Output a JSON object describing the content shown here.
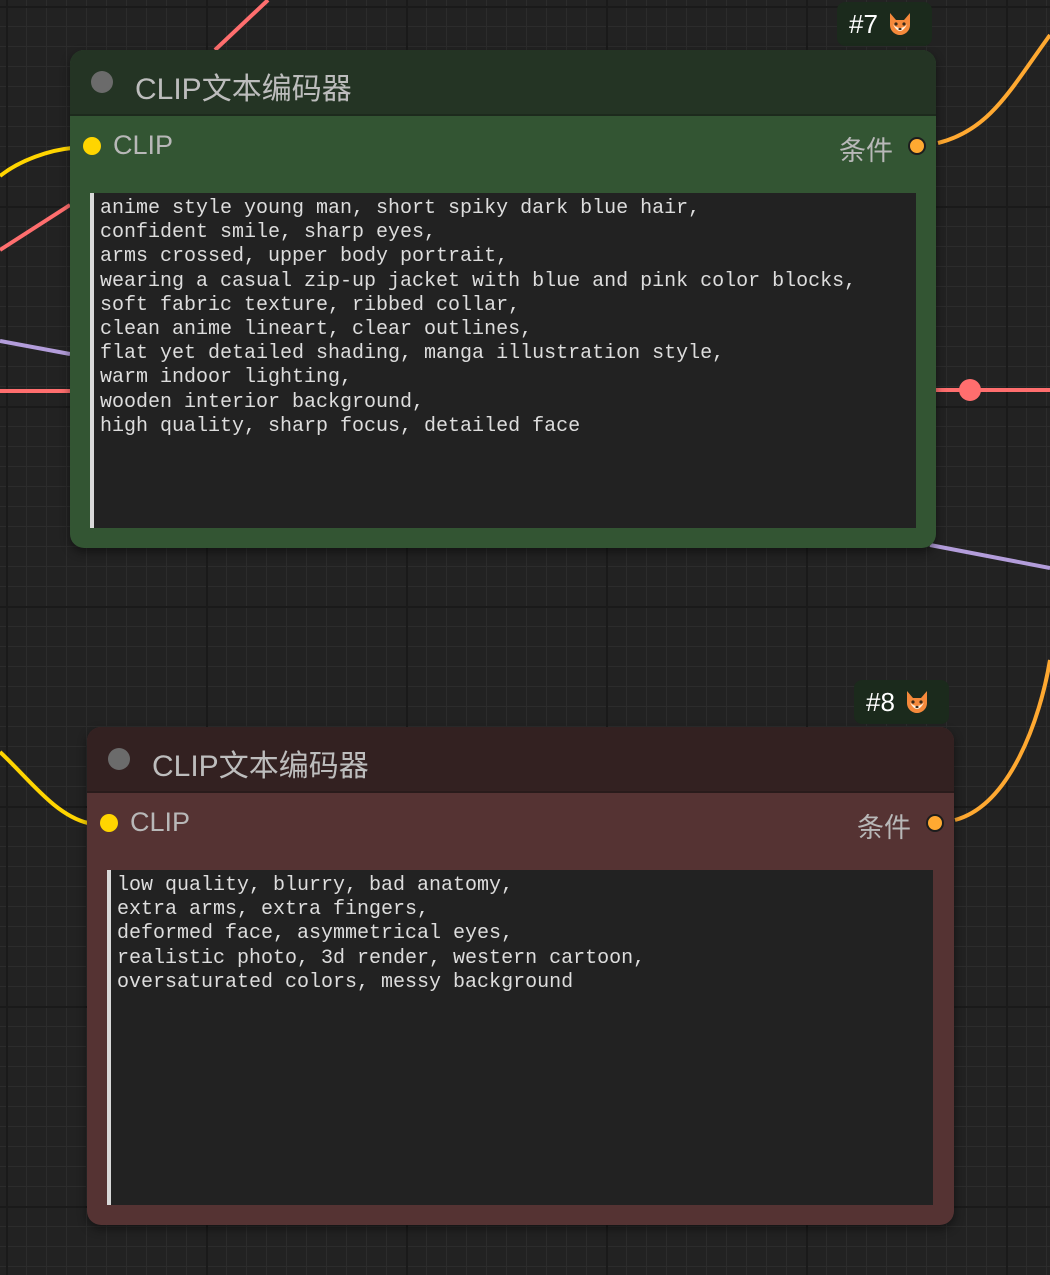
{
  "nodes": [
    {
      "id_badge": "#7",
      "title": "CLIP文本编码器",
      "input_label": "CLIP",
      "output_label": "条件",
      "prompt": "anime style young man, short spiky dark blue hair,\nconfident smile, sharp eyes,\narms crossed, upper body portrait,\nwearing a casual zip-up jacket with blue and pink color blocks,\nsoft fabric texture, ribbed collar,\nclean anime lineart, clear outlines,\nflat yet detailed shading, manga illustration style,\nwarm indoor lighting,\nwooden interior background,\nhigh quality, sharp focus, detailed face",
      "header_color": "#243424",
      "body_color": "#335533",
      "badge_icon": "fox-icon"
    },
    {
      "id_badge": "#8",
      "title": "CLIP文本编码器",
      "input_label": "CLIP",
      "output_label": "条件",
      "prompt": "low quality, blurry, bad anatomy,\nextra arms, extra fingers,\ndeformed face, asymmetrical eyes,\nrealistic photo, 3d render, western cartoon,\noversaturated colors, messy background",
      "header_color": "#332121",
      "body_color": "#553333",
      "badge_icon": "fox-icon"
    }
  ],
  "wire_colors": {
    "clip": "#ffd500",
    "conditioning": "#ffa931",
    "vae_image": "#ff6e6e",
    "latent": "#b39ddb"
  }
}
